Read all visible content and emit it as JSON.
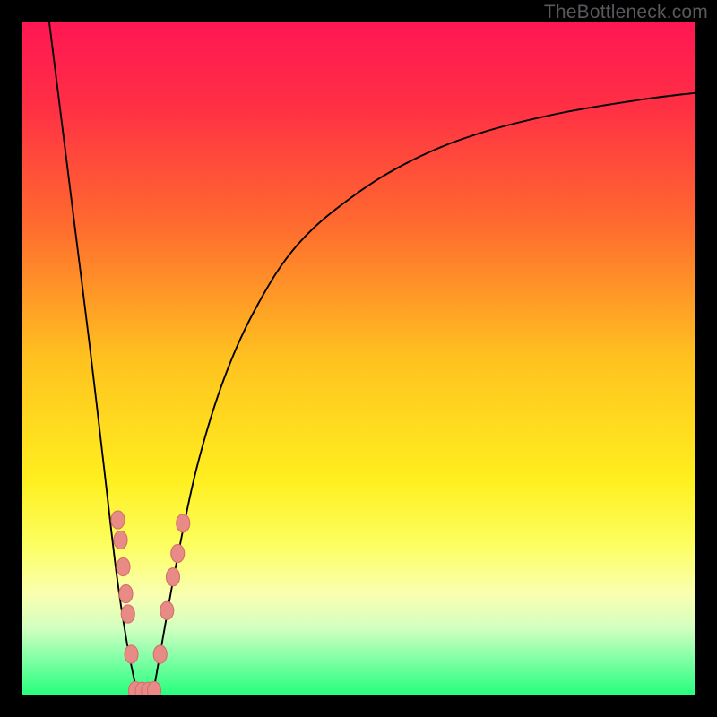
{
  "watermark": "TheBottleneck.com",
  "colors": {
    "frame": "#000000",
    "curve": "#000000",
    "marker_fill": "#e88b87",
    "marker_stroke": "#d46f6b",
    "gradient_stops": [
      {
        "offset": 0.0,
        "color": "#ff1754"
      },
      {
        "offset": 0.12,
        "color": "#ff2e45"
      },
      {
        "offset": 0.3,
        "color": "#ff6a2f"
      },
      {
        "offset": 0.5,
        "color": "#ffc21f"
      },
      {
        "offset": 0.68,
        "color": "#ffef1f"
      },
      {
        "offset": 0.78,
        "color": "#fcff63"
      },
      {
        "offset": 0.85,
        "color": "#faffb0"
      },
      {
        "offset": 0.9,
        "color": "#d4ffc0"
      },
      {
        "offset": 0.94,
        "color": "#8dffab"
      },
      {
        "offset": 1.0,
        "color": "#27ff7e"
      }
    ]
  },
  "chart_data": {
    "type": "line",
    "title": "",
    "xlabel": "",
    "ylabel": "",
    "xlim": [
      0,
      100
    ],
    "ylim": [
      0,
      100
    ],
    "series": [
      {
        "name": "left-branch",
        "x": [
          4.0,
          6,
          8,
          10,
          12,
          14,
          15.5,
          17
        ],
        "values": [
          100,
          84,
          68,
          52,
          35,
          18,
          8,
          0.5
        ]
      },
      {
        "name": "right-branch",
        "x": [
          19.5,
          21,
          23,
          26,
          30,
          35,
          41,
          49,
          58,
          68,
          80,
          92,
          100
        ],
        "values": [
          0.5,
          9,
          20,
          34,
          47,
          58,
          67,
          74,
          79.5,
          83.5,
          86.5,
          88.5,
          89.5
        ]
      }
    ],
    "markers": [
      {
        "series": "left-branch",
        "x": 14.2,
        "y": 26.0
      },
      {
        "series": "left-branch",
        "x": 14.6,
        "y": 23.0
      },
      {
        "series": "left-branch",
        "x": 15.0,
        "y": 19.0
      },
      {
        "series": "left-branch",
        "x": 15.4,
        "y": 15.0
      },
      {
        "series": "left-branch",
        "x": 15.7,
        "y": 12.0
      },
      {
        "series": "left-branch",
        "x": 16.2,
        "y": 6.0
      },
      {
        "series": "valley",
        "x": 16.8,
        "y": 0.6
      },
      {
        "series": "valley",
        "x": 17.8,
        "y": 0.5
      },
      {
        "series": "valley",
        "x": 18.7,
        "y": 0.5
      },
      {
        "series": "valley",
        "x": 19.6,
        "y": 0.6
      },
      {
        "series": "right-branch",
        "x": 20.5,
        "y": 6.0
      },
      {
        "series": "right-branch",
        "x": 21.5,
        "y": 12.5
      },
      {
        "series": "right-branch",
        "x": 22.4,
        "y": 17.5
      },
      {
        "series": "right-branch",
        "x": 23.1,
        "y": 21.0
      },
      {
        "series": "right-branch",
        "x": 23.9,
        "y": 25.5
      }
    ],
    "note": "x and y in percent of plot area; y=0 is bottom (green), y=100 is top (red)."
  }
}
